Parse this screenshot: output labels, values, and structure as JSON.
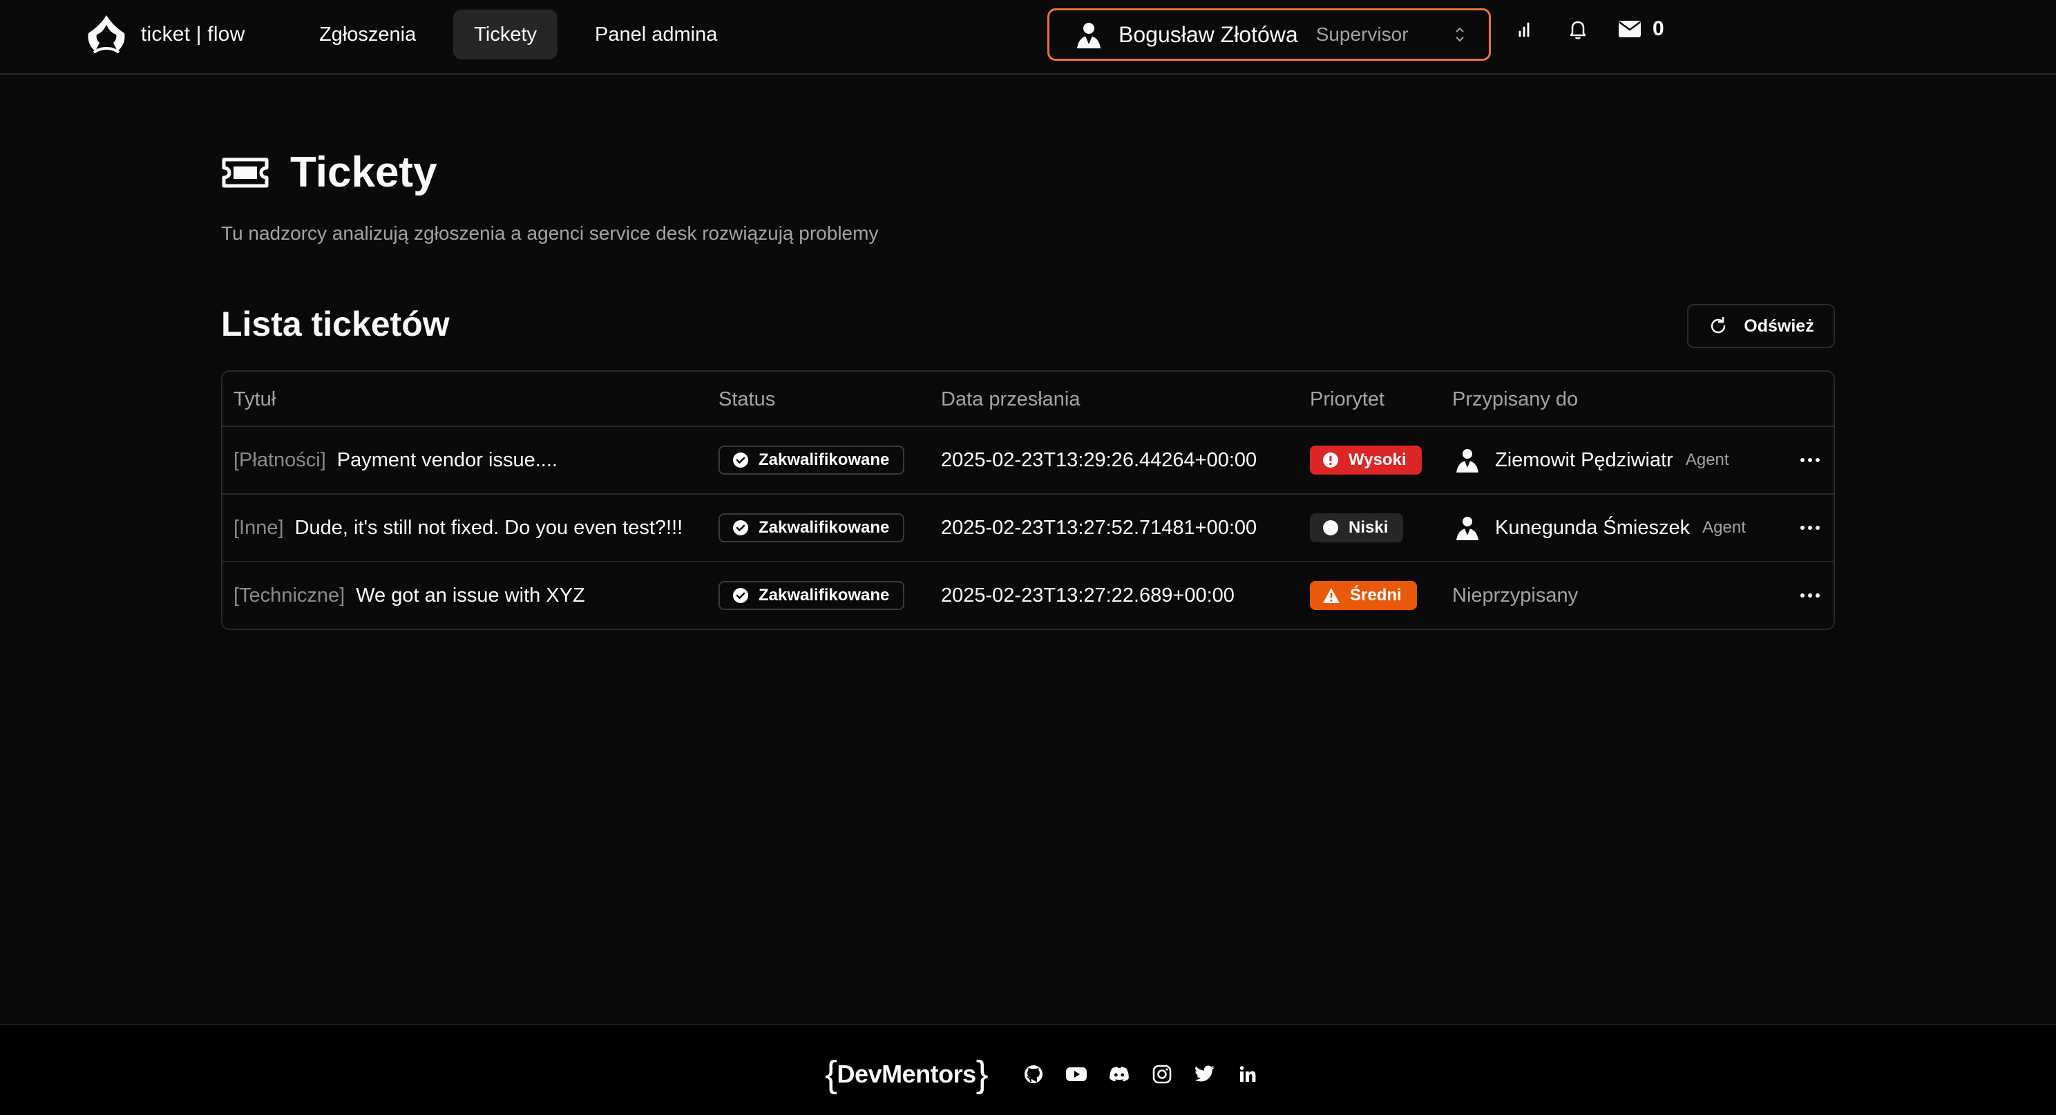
{
  "brand": {
    "name": "ticket | flow"
  },
  "nav": [
    {
      "label": "Zgłoszenia",
      "active": false
    },
    {
      "label": "Tickety",
      "active": true
    },
    {
      "label": "Panel admina",
      "active": false
    }
  ],
  "user": {
    "name": "Bogusław Złotówa",
    "role": "Supervisor"
  },
  "header_icons": {
    "stats": "bar-chart-icon",
    "notifications": "bell-icon",
    "messages": "mail-icon",
    "message_count": "0"
  },
  "page": {
    "title": "Tickety",
    "subtitle": "Tu nadzorcy analizują zgłoszenia a agenci service desk rozwiązują problemy"
  },
  "section": {
    "title": "Lista ticketów",
    "refresh_label": "Odśwież"
  },
  "table": {
    "columns": [
      "Tytuł",
      "Status",
      "Data przesłania",
      "Priorytet",
      "Przypisany do"
    ],
    "rows": [
      {
        "category": "[Płatności]",
        "title": "Payment vendor issue....",
        "status": "Zakwalifikowane",
        "date": "2025-02-23T13:29:26.44264+00:00",
        "priority": "Wysoki",
        "priority_color": "#dc2626",
        "priority_icon": "alert-circle-icon",
        "assignee": "Ziemowit Pędziwiatr",
        "assignee_role": "Agent"
      },
      {
        "category": "[Inne]",
        "title": "Dude, it's still not fixed. Do you even test?!!!",
        "status": "Zakwalifikowane",
        "date": "2025-02-23T13:27:52.71481+00:00",
        "priority": "Niski",
        "priority_color": "#262626",
        "priority_icon": "circle-icon",
        "assignee": "Kunegunda Śmieszek",
        "assignee_role": "Agent"
      },
      {
        "category": "[Techniczne]",
        "title": "We got an issue with XYZ",
        "status": "Zakwalifikowane",
        "date": "2025-02-23T13:27:22.689+00:00",
        "priority": "Średni",
        "priority_color": "#ea580c",
        "priority_icon": "warning-triangle-icon",
        "assignee": "",
        "assignee_role": "",
        "unassigned_label": "Nieprzypisany"
      }
    ]
  },
  "footer": {
    "logo_text": "DevMentors",
    "social": [
      "github-icon",
      "youtube-icon",
      "discord-icon",
      "instagram-icon",
      "twitter-icon",
      "linkedin-icon"
    ]
  }
}
